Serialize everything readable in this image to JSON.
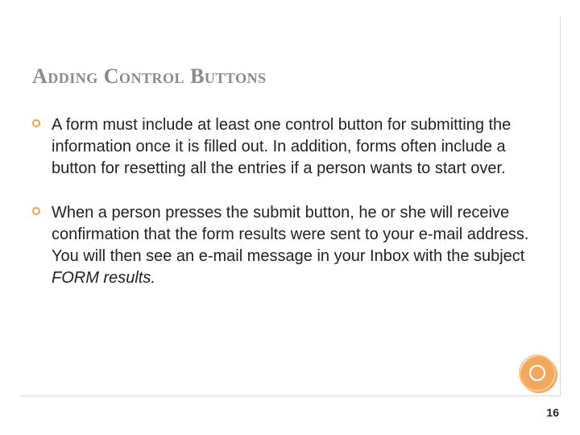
{
  "title": "Adding Control Buttons",
  "bullets": [
    {
      "text": "A form must include at least one control button for submitting the information once it is filled out. In addition, forms often include a button for resetting all the entries if a person wants to start over."
    },
    {
      "text": "When a person presses the submit button, he or she will receive confirmation that the form results were sent to your e-mail address. You will then see an e-mail message in your Inbox with the subject ",
      "italic_suffix": "FORM results."
    }
  ],
  "page_number": "16"
}
